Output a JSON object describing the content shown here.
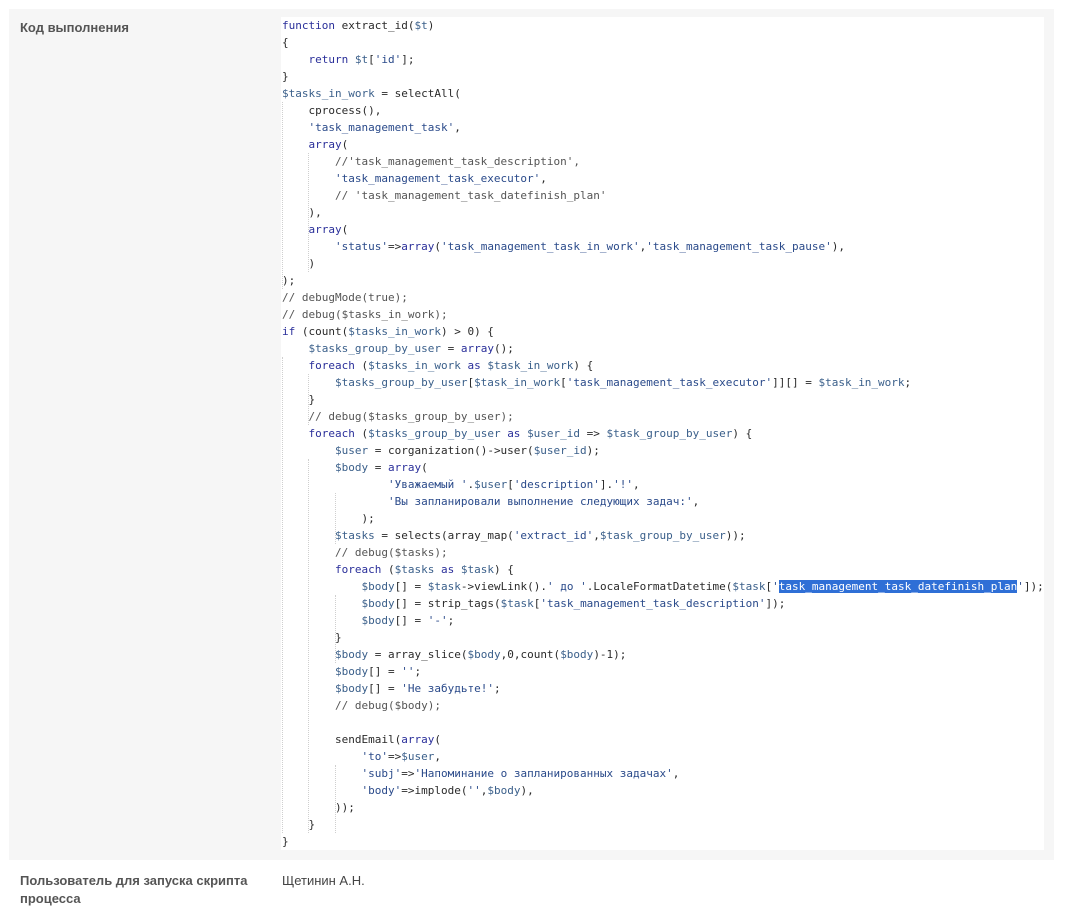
{
  "fields": {
    "code_label": "Код выполнения",
    "user_label": "Пользователь для запуска скрипта процесса",
    "user_value": "Щетинин А.Н."
  },
  "code": {
    "selected_text": "task_management_task_datefinish_plan",
    "lines": [
      "function extract_id($t)",
      "{",
      "    return $t['id'];",
      "}",
      "$tasks_in_work = selectAll(",
      "    cprocess(),",
      "    'task_management_task',",
      "    array(",
      "        //'task_management_task_description',",
      "        'task_management_task_executor',",
      "        // 'task_management_task_datefinish_plan'",
      "    ),",
      "    array(",
      "        'status'=>array('task_management_task_in_work','task_management_task_pause'),",
      "    )",
      ");",
      "// debugMode(true);",
      "// debug($tasks_in_work);",
      "if (count($tasks_in_work) > 0) {",
      "    $tasks_group_by_user = array();",
      "    foreach ($tasks_in_work as $task_in_work) {",
      "        $tasks_group_by_user[$task_in_work['task_management_task_executor']][] = $task_in_work;",
      "    }",
      "    // debug($tasks_group_by_user);",
      "    foreach ($tasks_group_by_user as $user_id => $task_group_by_user) {",
      "        $user = corganization()->user($user_id);",
      "        $body = array(",
      "                'Уважаемый '.$user['description'].'!',",
      "                'Вы запланировали выполнение следующих задач:',",
      "            );",
      "        $tasks = selects(array_map('extract_id',$task_group_by_user));",
      "        // debug($tasks);",
      "        foreach ($tasks as $task) {",
      "            $body[] = $task->viewLink().' до '.LocaleFormatDatetime($task['task_management_task_datefinish_plan']);",
      "            $body[] = strip_tags($task['task_management_task_description']);",
      "            $body[] = '-';",
      "        }",
      "        $body = array_slice($body,0,count($body)-1);",
      "        $body[] = '';",
      "        $body[] = 'Не забудьте!';",
      "        // debug($body);",
      "",
      "        sendEmail(array(",
      "            'to'=>$user,",
      "            'subj'=>'Напоминание о запланированных задачах',",
      "            'body'=>implode('',$body),",
      "        ));",
      "    }",
      "}"
    ]
  }
}
